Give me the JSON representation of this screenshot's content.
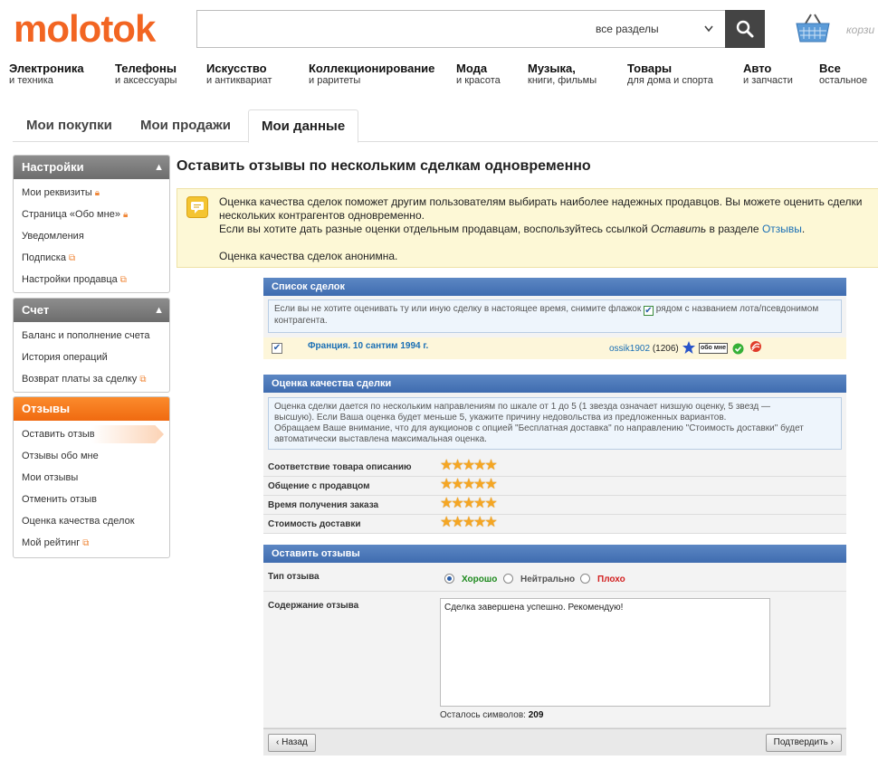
{
  "header": {
    "logo": "molotok",
    "search": {
      "placeholder": "",
      "section": "все разделы"
    },
    "basket_label": "корзи"
  },
  "categories": [
    {
      "title": "Электроника",
      "sub": "и техника"
    },
    {
      "title": "Телефоны",
      "sub": "и аксессуары"
    },
    {
      "title": "Искусство",
      "sub": "и антиквариат"
    },
    {
      "title": "Коллекционирование",
      "sub": "и раритеты"
    },
    {
      "title": "Мода",
      "sub": "и красота"
    },
    {
      "title": "Музыка,",
      "sub": "книги, фильмы"
    },
    {
      "title": "Товары",
      "sub": "для дома и спорта"
    },
    {
      "title": "Авто",
      "sub": "и запчасти"
    },
    {
      "title": "Все",
      "sub": "остальное"
    }
  ],
  "tabs": [
    {
      "label": "Мои покупки"
    },
    {
      "label": "Мои продажи"
    },
    {
      "label": "Мои данные"
    }
  ],
  "sidebar": {
    "settings": {
      "title": "Настройки",
      "items": [
        "Мои реквизиты",
        "Страница «Обо мне»",
        "Уведомления",
        "Подписка",
        "Настройки продавца"
      ]
    },
    "account": {
      "title": "Счет",
      "items": [
        "Баланс и пополнение счета",
        "История операций",
        "Возврат платы за сделку"
      ]
    },
    "feedback": {
      "title": "Отзывы",
      "items": [
        "Оставить отзыв",
        "Отзывы обо мне",
        "Мои отзывы",
        "Отменить отзыв",
        "Оценка качества сделок",
        "Мой рейтинг"
      ]
    }
  },
  "main": {
    "title": "Оставить отзывы по нескольким сделкам одновременно",
    "notice": {
      "line1": "Оценка качества сделок поможет другим пользователям выбирать наиболее надежных продавцов. Вы можете оценить сделки",
      "line2": "нескольких контрагентов одновременно.",
      "line3_pre": "Если вы хотите дать разные оценки отдельным продавцам, воспользуйтесь ссылкой ",
      "line3_em": "Оставить",
      "line3_mid": " в разделе ",
      "line3_link": "Отзывы",
      "line3_end": ".",
      "line4": "Оценка качества сделок анонимна."
    },
    "deals": {
      "title": "Список сделок",
      "info_pre": "Если вы не хотите оценивать ту или иную сделку в настоящее время, снимите флажок",
      "info_post": "рядом с названием лота/псевдонимом контрагента.",
      "item": {
        "lot": "Франция. 10 сантим 1994 г.",
        "nick": "ossik1902",
        "count": "(1206)",
        "about_badge": "обо мне",
        "checked": true
      }
    },
    "quality": {
      "title": "Оценка качества сделки",
      "info1": "Оценка сделки дается по нескольким направлениям по шкале от 1 до 5 (1 звезда означает низшую оценку, 5 звезд —",
      "info2": "высшую). Если Ваша оценка будет меньше 5, укажите причину недовольства из предложенных вариантов.",
      "info3": "Обращаем Ваше внимание, что для аукционов с опцией \"Бесплатная доставка\" по направлению \"Стоимость доставки\" будет",
      "info4": "автоматически выставлена максимальная оценка.",
      "criteria": [
        {
          "label": "Соответствие товара описанию",
          "stars": 5
        },
        {
          "label": "Общение с продавцом",
          "stars": 5
        },
        {
          "label": "Время получения заказа",
          "stars": 5
        },
        {
          "label": "Стоимость доставки",
          "stars": 5
        }
      ]
    },
    "leave": {
      "title": "Оставить отзывы",
      "type_label": "Тип отзыва",
      "options": [
        {
          "label": "Хорошо",
          "color": "#1e8a1e",
          "selected": true
        },
        {
          "label": "Нейтрально",
          "color": "#555555",
          "selected": false
        },
        {
          "label": "Плохо",
          "color": "#d22020",
          "selected": false
        }
      ],
      "content_label": "Содержание отзыва",
      "content_value": "Сделка завершена успешно. Рекомендую!",
      "remaining_label": "Осталось символов:",
      "remaining_value": "209"
    },
    "buttons": {
      "back": "‹ Назад",
      "confirm": "Подтвердить ›"
    }
  }
}
